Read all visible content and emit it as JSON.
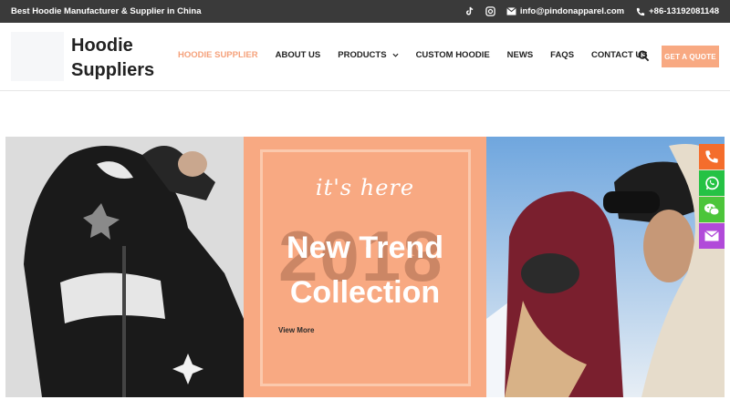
{
  "topbar": {
    "tagline": "Best Hoodie Manufacturer & Supplier in China",
    "email": "info@pindonapparel.com",
    "phone": "+86-13192081148"
  },
  "header": {
    "brand_line1": "Hoodie",
    "brand_line2": "Suppliers",
    "nav": [
      {
        "label": "Hoodie Supplier",
        "active": true
      },
      {
        "label": "About Us"
      },
      {
        "label": "Products",
        "dropdown": true
      },
      {
        "label": "Custom Hoodie"
      },
      {
        "label": "News"
      },
      {
        "label": "FAQs"
      },
      {
        "label": "Contact Us"
      }
    ],
    "quote_button": "Get A Quote"
  },
  "hero": {
    "script": "it's here",
    "year": "2018",
    "headline_line1": "New Trend",
    "headline_line2": "Collection",
    "view_more": "View More"
  },
  "side_contacts": [
    "phone-icon",
    "whatsapp-icon",
    "wechat-icon",
    "email-icon"
  ],
  "colors": {
    "accent": "#f8a982",
    "topbar": "#3a3a3a"
  }
}
